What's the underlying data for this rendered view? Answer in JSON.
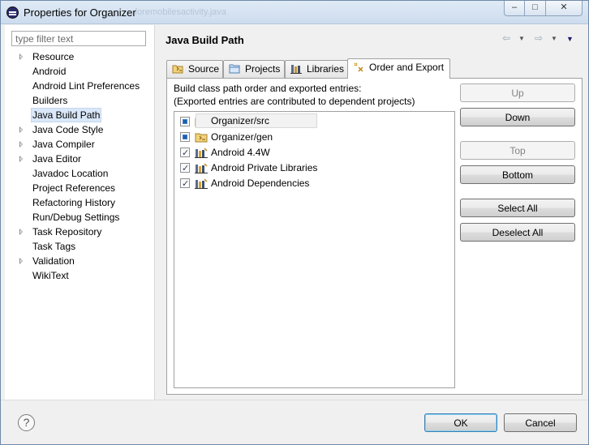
{
  "window": {
    "title": "Properties for Organizer",
    "ghost_title": "foremobilesactivity.java",
    "controls": {
      "minimize": "–",
      "maximize": "□",
      "close": "✕"
    }
  },
  "filter": {
    "placeholder": "type filter text",
    "value": ""
  },
  "tree": {
    "items": [
      {
        "label": "Resource",
        "expandable": true
      },
      {
        "label": "Android",
        "expandable": false
      },
      {
        "label": "Android Lint Preferences",
        "expandable": false
      },
      {
        "label": "Builders",
        "expandable": false
      },
      {
        "label": "Java Build Path",
        "expandable": false,
        "selected": true
      },
      {
        "label": "Java Code Style",
        "expandable": true
      },
      {
        "label": "Java Compiler",
        "expandable": true
      },
      {
        "label": "Java Editor",
        "expandable": true
      },
      {
        "label": "Javadoc Location",
        "expandable": false
      },
      {
        "label": "Project References",
        "expandable": false
      },
      {
        "label": "Refactoring History",
        "expandable": false
      },
      {
        "label": "Run/Debug Settings",
        "expandable": false
      },
      {
        "label": "Task Repository",
        "expandable": true
      },
      {
        "label": "Task Tags",
        "expandable": false
      },
      {
        "label": "Validation",
        "expandable": true
      },
      {
        "label": "WikiText",
        "expandable": false
      }
    ]
  },
  "page": {
    "title": "Java Build Path",
    "nav": {
      "back": "⇦",
      "forward": "⇨",
      "dropdown": "▼",
      "menu": "▼"
    }
  },
  "tabs": [
    {
      "label": "Source",
      "icon": "source-folder-icon"
    },
    {
      "label": "Projects",
      "icon": "projects-icon"
    },
    {
      "label": "Libraries",
      "icon": "libraries-icon"
    },
    {
      "label": "Order and Export",
      "icon": "order-export-icon",
      "active": true
    }
  ],
  "order_export": {
    "description_line1": "Build class path order and exported entries:",
    "description_line2": "(Exported entries are contributed to dependent projects)",
    "entries": [
      {
        "label": "Organizer/src",
        "state": "filled",
        "icon": "source-folder-icon"
      },
      {
        "label": "Organizer/gen",
        "state": "filled",
        "icon": "source-folder-icon"
      },
      {
        "label": "Android 4.4W",
        "state": "checked",
        "icon": "library-icon"
      },
      {
        "label": "Android Private Libraries",
        "state": "checked",
        "icon": "library-icon"
      },
      {
        "label": "Android Dependencies",
        "state": "checked",
        "icon": "library-icon"
      }
    ],
    "buttons": {
      "up": "Up",
      "down": "Down",
      "top": "Top",
      "bottom": "Bottom",
      "select_all": "Select All",
      "deselect_all": "Deselect All"
    }
  },
  "footer": {
    "help": "?",
    "ok": "OK",
    "cancel": "Cancel"
  }
}
